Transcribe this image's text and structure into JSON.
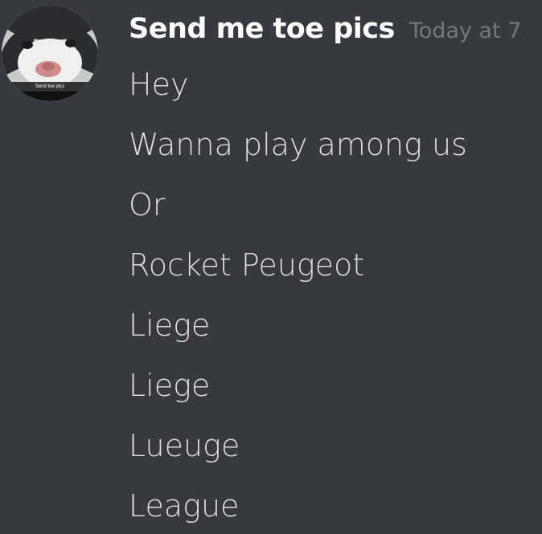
{
  "message_group": {
    "author": {
      "name": "Send me toe pics",
      "avatar_caption": "Send toe pics",
      "avatar_icon": "cat-avatar-icon"
    },
    "timestamp": "Today at 7",
    "messages": [
      "Hey",
      "Wanna play among us",
      "Or",
      "Rocket Peugeot",
      "Liege",
      "Liege",
      "Lueuge",
      "League"
    ]
  },
  "colors": {
    "background": "#36393f",
    "username": "#ffffff",
    "timestamp": "#72767d",
    "message_text": "#dcddde"
  }
}
